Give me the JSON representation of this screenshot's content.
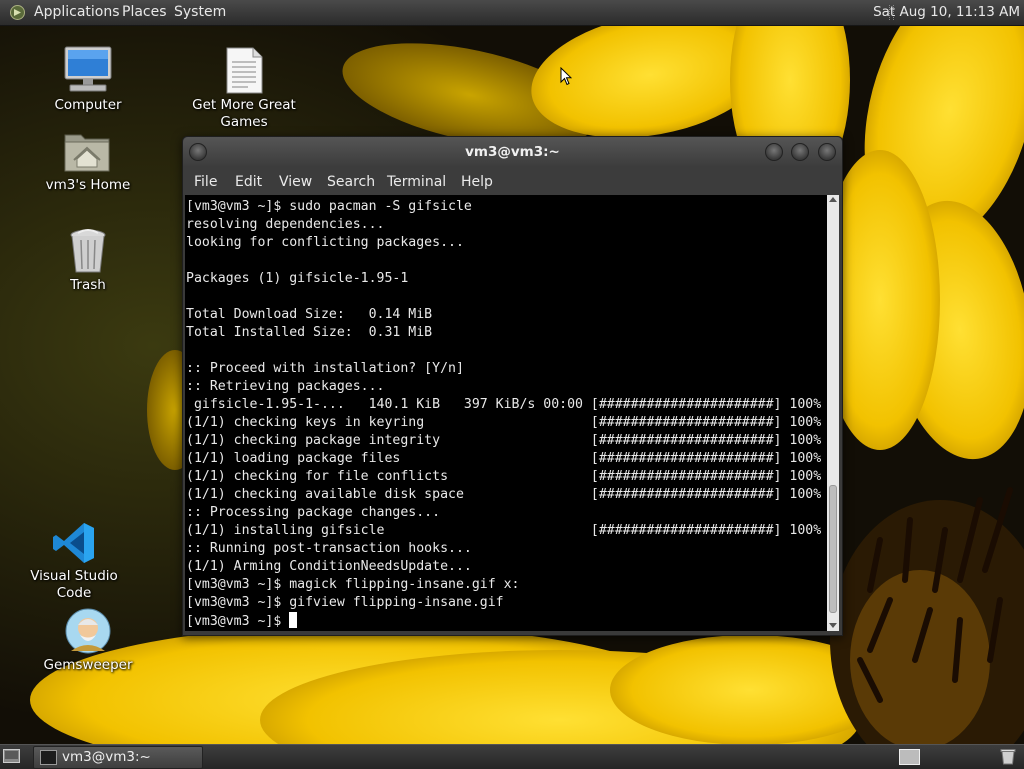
{
  "top_panel": {
    "menus": [
      "Applications",
      "Places",
      "System"
    ],
    "clock": "Sat Aug 10, 11:13 AM"
  },
  "desktop": {
    "icons": [
      {
        "label": "Computer",
        "icon": "computer-icon"
      },
      {
        "label": "Get More Great Games",
        "icon": "document-icon"
      },
      {
        "label": "vm3's Home",
        "icon": "home-folder-icon"
      },
      {
        "label": "Trash",
        "icon": "trash-icon"
      },
      {
        "label": "Visual Studio Code",
        "icon": "vscode-icon"
      },
      {
        "label": "Gemsweeper",
        "icon": "gemsweeper-icon"
      }
    ]
  },
  "terminal": {
    "title": "vm3@vm3:~",
    "menus": [
      "File",
      "Edit",
      "View",
      "Search",
      "Terminal",
      "Help"
    ],
    "lines": [
      "[vm3@vm3 ~]$ sudo pacman -S gifsicle",
      "resolving dependencies...",
      "looking for conflicting packages...",
      "",
      "Packages (1) gifsicle-1.95-1",
      "",
      "Total Download Size:   0.14 MiB",
      "Total Installed Size:  0.31 MiB",
      "",
      ":: Proceed with installation? [Y/n]",
      ":: Retrieving packages...",
      " gifsicle-1.95-1-...   140.1 KiB   397 KiB/s 00:00 [######################] 100%",
      "(1/1) checking keys in keyring                     [######################] 100%",
      "(1/1) checking package integrity                   [######################] 100%",
      "(1/1) loading package files                        [######################] 100%",
      "(1/1) checking for file conflicts                  [######################] 100%",
      "(1/1) checking available disk space                [######################] 100%",
      ":: Processing package changes...",
      "(1/1) installing gifsicle                          [######################] 100%",
      ":: Running post-transaction hooks...",
      "(1/1) Arming ConditionNeedsUpdate...",
      "[vm3@vm3 ~]$ magick flipping-insane.gif x:",
      "[vm3@vm3 ~]$ gifview flipping-insane.gif",
      "[vm3@vm3 ~]$ "
    ]
  },
  "bottom_panel": {
    "task_label": "vm3@vm3:~"
  }
}
